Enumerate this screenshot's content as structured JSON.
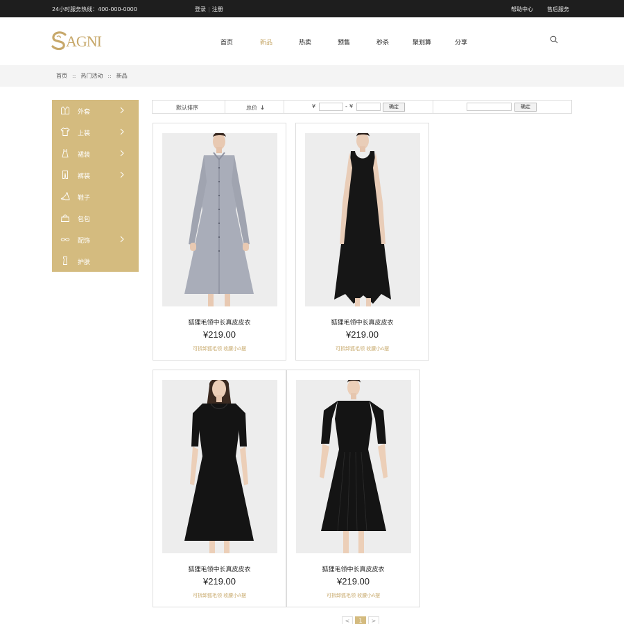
{
  "topbar": {
    "hotline": "24小时服务热线：400-000-0000",
    "login": "登录",
    "register": "注册",
    "help": "帮助中心",
    "after_sales": "售后服务"
  },
  "brand": {
    "logo_text": "AGNI"
  },
  "nav": [
    {
      "label": "首页",
      "active": false
    },
    {
      "label": "新品",
      "active": true
    },
    {
      "label": "热卖",
      "active": false
    },
    {
      "label": "预售",
      "active": false
    },
    {
      "label": "秒杀",
      "active": false
    },
    {
      "label": "聚划算",
      "active": false
    },
    {
      "label": "分享",
      "active": false
    }
  ],
  "breadcrumb": {
    "items": [
      "首页",
      "热门活动",
      "新品"
    ],
    "separator": "::"
  },
  "sidebar": {
    "items": [
      {
        "label": "外套",
        "icon": "coat-icon",
        "has_arrow": true
      },
      {
        "label": "上装",
        "icon": "shirt-icon",
        "has_arrow": true
      },
      {
        "label": "裙装",
        "icon": "dress-icon",
        "has_arrow": true
      },
      {
        "label": "裤装",
        "icon": "pants-icon",
        "has_arrow": true
      },
      {
        "label": "鞋子",
        "icon": "heel-icon",
        "has_arrow": false
      },
      {
        "label": "包包",
        "icon": "bag-icon",
        "has_arrow": false
      },
      {
        "label": "配饰",
        "icon": "glasses-icon",
        "has_arrow": true
      },
      {
        "label": "护肤",
        "icon": "lotion-icon",
        "has_arrow": false
      }
    ]
  },
  "filter": {
    "default_sort": "默认排序",
    "total_price": "总价",
    "currency": "¥",
    "range_dash": "-",
    "confirm": "确定",
    "confirm2": "确定"
  },
  "products": [
    {
      "title": "狐狸毛领中长真皮皮衣",
      "price": "¥219.00",
      "subtitle": "可拆卸狐毛领 收腰小A摆",
      "style": "gray-shirt-dress"
    },
    {
      "title": "狐狸毛领中长真皮皮衣",
      "price": "¥219.00",
      "subtitle": "可拆卸狐毛领 收腰小A摆",
      "style": "black-tank-dress"
    },
    {
      "title": "狐狸毛领中长真皮皮衣",
      "price": "¥219.00",
      "subtitle": "可拆卸狐毛领 收腰小A摆",
      "style": "black-pleat-dress"
    },
    {
      "title": "狐狸毛领中长真皮皮衣",
      "price": "¥219.00",
      "subtitle": "可拆卸狐毛领 收腰小A摆",
      "style": "black-knit-dress"
    }
  ],
  "pagination": {
    "prev": "<",
    "current": "1",
    "next": ">"
  },
  "colors": {
    "accent": "#c7a86a",
    "sidebar": "#d4bb7f",
    "topbar": "#1e1e1e"
  }
}
